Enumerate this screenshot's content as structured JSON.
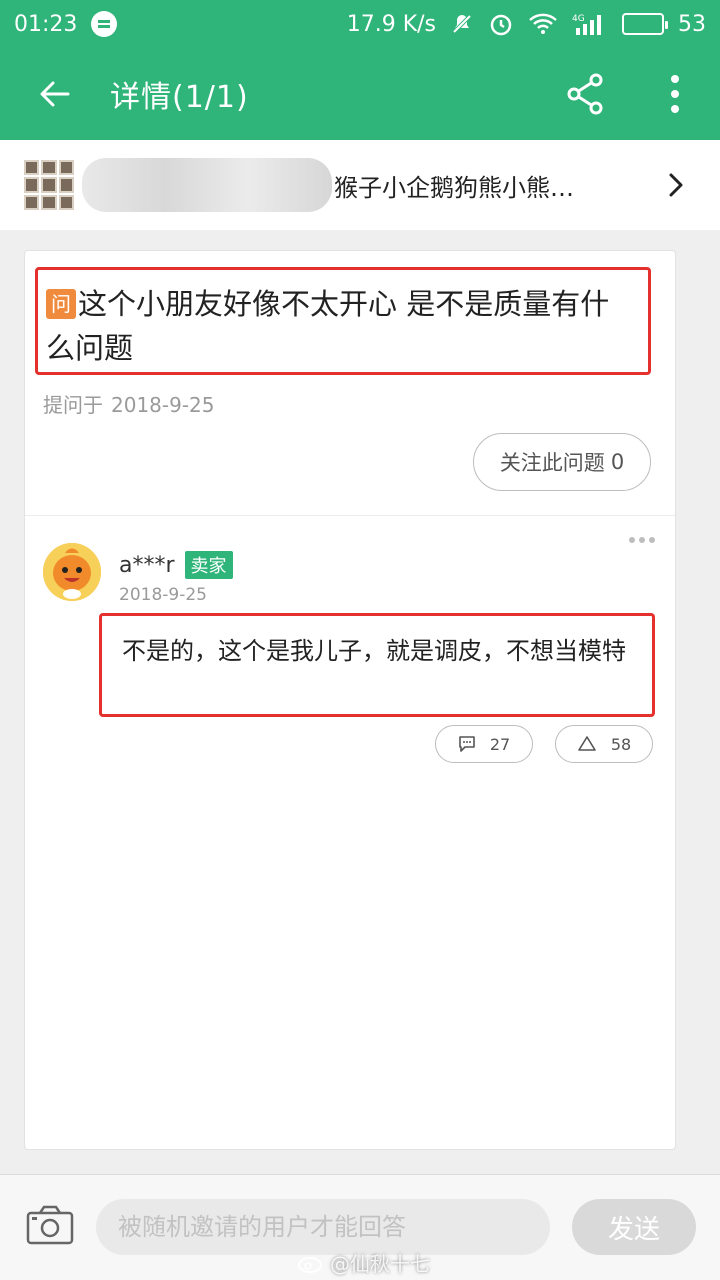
{
  "status_bar": {
    "time": "01:23",
    "net_speed": "17.9 K/s",
    "signal": "4G",
    "battery": "53",
    "battery_level": 0.53
  },
  "header": {
    "title": "详情(1/1)"
  },
  "product": {
    "name": "猴子小企鹅狗熊小熊…"
  },
  "question": {
    "badge": "问",
    "text": "这个小朋友好像不太开心 是不是质量有什么问题",
    "asked_label": "提问于",
    "date": "2018-9-25",
    "follow_label": "关注此问题",
    "follow_count": "0"
  },
  "answer": {
    "user": "a***r",
    "role_tag": "卖家",
    "date": "2018-9-25",
    "text": "不是的，这个是我儿子，就是调皮，不想当模特",
    "comment_count": "27",
    "like_count": "58"
  },
  "composer": {
    "placeholder": "被随机邀请的用户才能回答",
    "send_label": "发送"
  },
  "watermark": "@仙秋十七",
  "colors": {
    "brand_green": "#2fb479",
    "highlight_red": "#e5312d",
    "question_badge": "#f08a3c"
  }
}
